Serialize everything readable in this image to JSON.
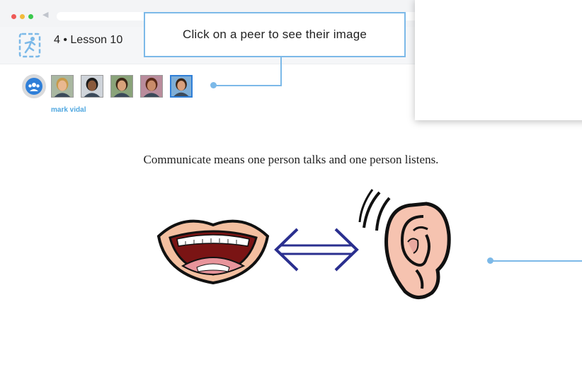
{
  "lesson": {
    "title": "4 • Lesson 10"
  },
  "tooltip": {
    "text": "Click on a peer to see their image"
  },
  "peers": {
    "selected_name": "mark vidal",
    "avatars": [
      {
        "name": "peer-avatar-1",
        "skin": "#e9b891",
        "hair": "#c79a4a",
        "bg": "#a9b7a1"
      },
      {
        "name": "peer-avatar-2",
        "skin": "#8a5a3c",
        "hair": "#1b1b1b",
        "bg": "#cfd4da"
      },
      {
        "name": "peer-avatar-3",
        "skin": "#d7a27a",
        "hair": "#3b2616",
        "bg": "#8aa37a"
      },
      {
        "name": "peer-avatar-4",
        "skin": "#c98c6a",
        "hair": "#5a2a18",
        "bg": "#b98c9c"
      },
      {
        "name": "peer-avatar-5",
        "skin": "#d9a07d",
        "hair": "#3a2415",
        "bg": "#7faed6"
      }
    ]
  },
  "slide": {
    "sentence": "Communicate means one person talks and one person listens."
  },
  "colors": {
    "accent": "#7cb9e8",
    "selected_border": "#2f7fd8",
    "peer_name": "#4fa7e0",
    "arrow": "#2a2f8f"
  }
}
